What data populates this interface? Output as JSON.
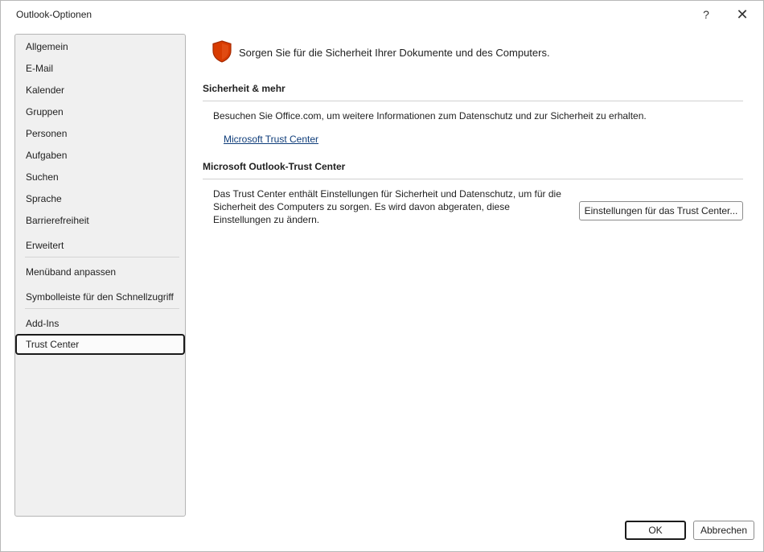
{
  "window": {
    "title": "Outlook-Optionen",
    "help_label": "?",
    "close_label": "✕"
  },
  "sidebar": {
    "items": [
      {
        "label": "Allgemein",
        "selected": false
      },
      {
        "label": "E-Mail",
        "selected": false
      },
      {
        "label": "Kalender",
        "selected": false
      },
      {
        "label": "Gruppen",
        "selected": false
      },
      {
        "label": "Personen",
        "selected": false
      },
      {
        "label": "Aufgaben",
        "selected": false
      },
      {
        "label": "Suchen",
        "selected": false
      },
      {
        "label": "Sprache",
        "selected": false
      },
      {
        "label": "Barrierefreiheit",
        "selected": false
      },
      {
        "label": "Erweitert",
        "selected": false
      },
      {
        "label": "Menüband anpassen",
        "selected": false
      },
      {
        "label": "Symbolleiste für den Schnellzugriff",
        "selected": false
      },
      {
        "label": "Add-Ins",
        "selected": false
      },
      {
        "label": "Trust Center",
        "selected": true
      }
    ]
  },
  "main": {
    "hero_icon": "shield-icon",
    "hero_text": "Sorgen Sie für die Sicherheit Ihrer Dokumente und des Computers.",
    "security": {
      "title": "Sicherheit & mehr",
      "description": "Besuchen Sie Office.com, um weitere Informationen zum Datenschutz und zur Sicherheit zu erhalten.",
      "link_label": "Microsoft Trust Center"
    },
    "trust_center": {
      "title": "Microsoft Outlook-Trust Center",
      "description": "Das Trust Center enthält Einstellungen für Sicherheit und Datenschutz, um für die Sicherheit des Computers zu sorgen. Es wird davon abgeraten, diese Einstellungen zu ändern.",
      "button_label": "Einstellungen für das Trust Center..."
    }
  },
  "footer": {
    "ok_label": "OK",
    "cancel_label": "Abbrechen"
  },
  "colors": {
    "shield_fill": "#d83b01",
    "shield_outline": "#a52a00",
    "link": "#0f3d7a"
  }
}
